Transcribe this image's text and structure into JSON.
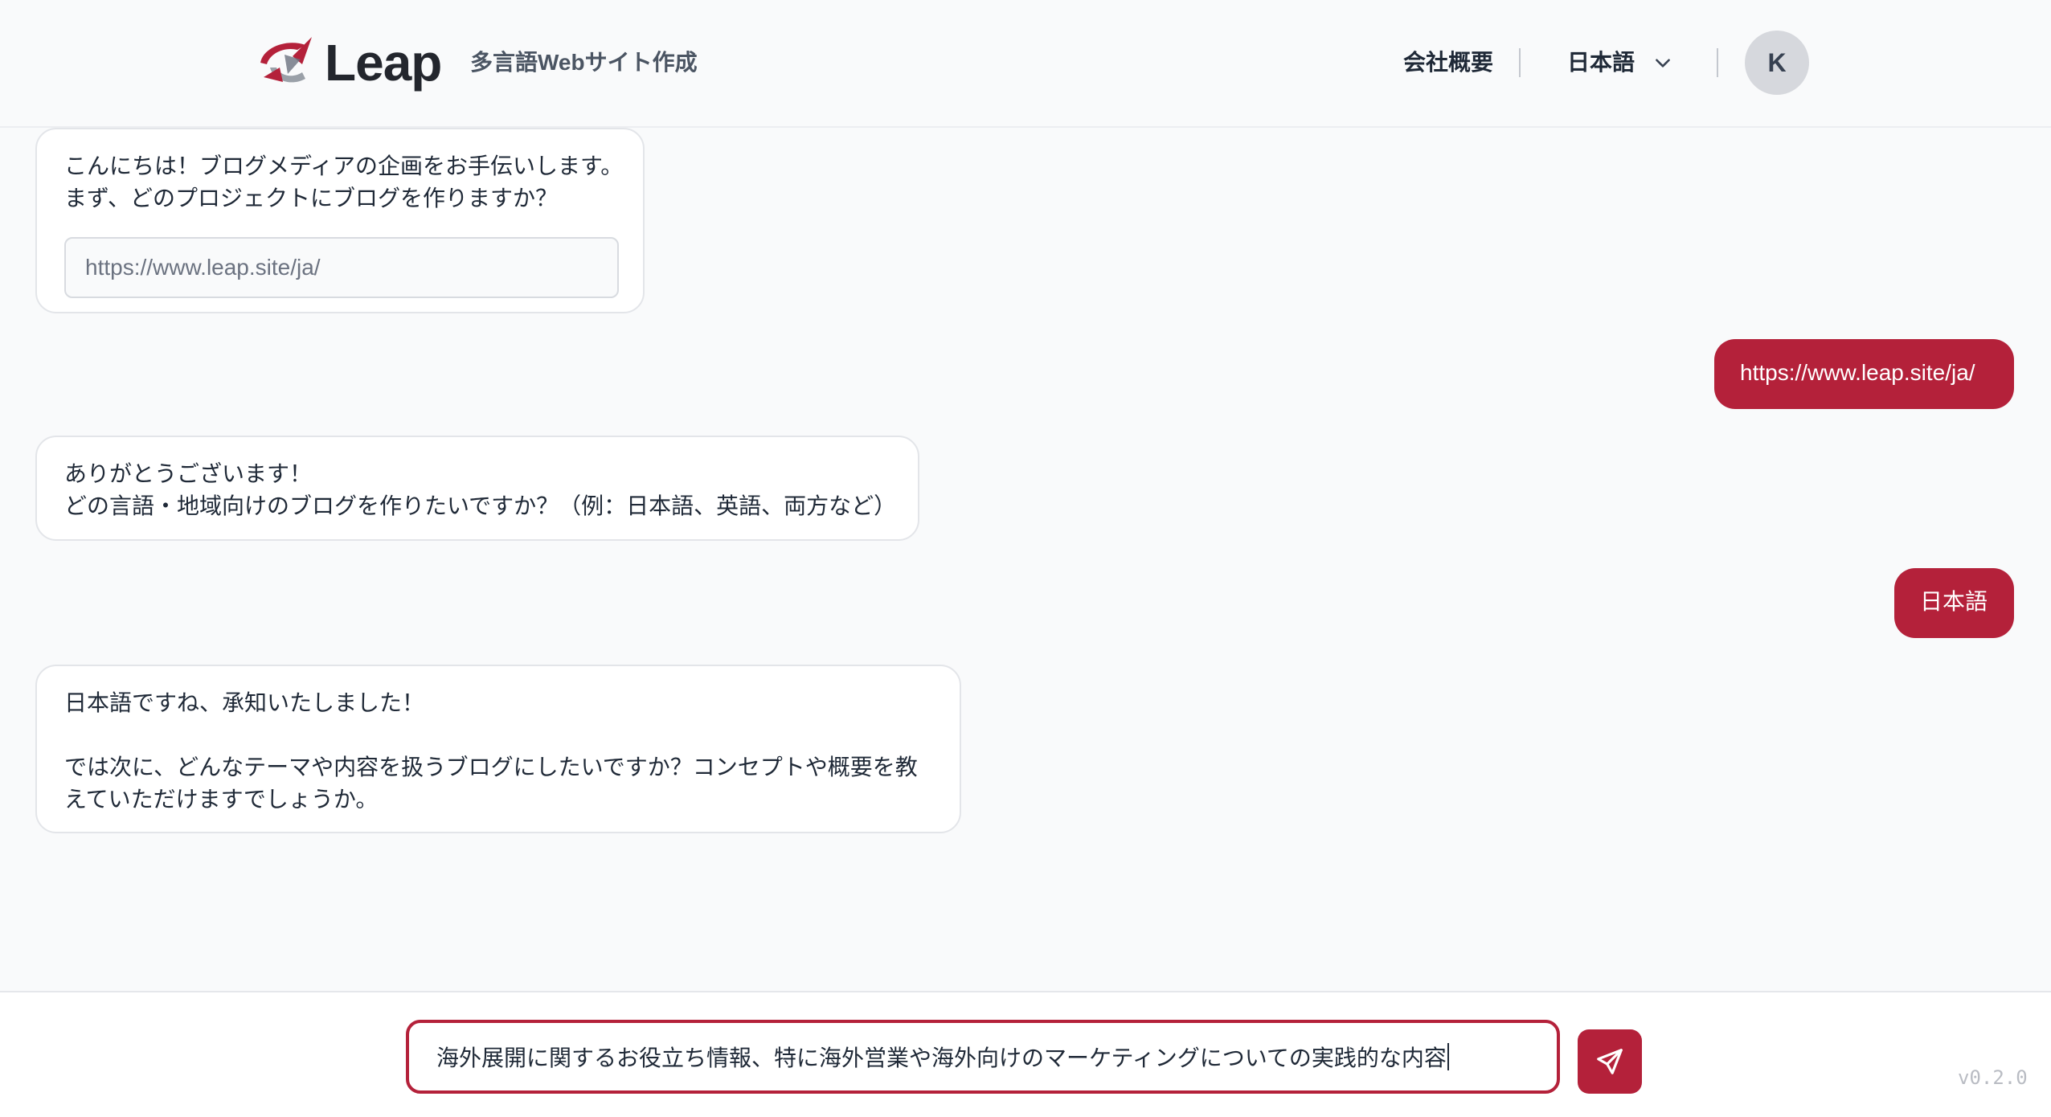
{
  "header": {
    "logo_text": "Leap",
    "tagline": "多言語Webサイト作成",
    "nav_about": "会社概要",
    "language": "日本語",
    "avatar_initial": "K"
  },
  "chat": {
    "messages": [
      {
        "role": "assistant",
        "lines": [
          "こんにちは！ブログメディアの企画をお手伝いします。",
          "まず、どのプロジェクトにブログを作りますか？"
        ],
        "input_value": "https://www.leap.site/ja/"
      },
      {
        "role": "user",
        "text": "https://www.leap.site/ja/"
      },
      {
        "role": "assistant",
        "lines": [
          "ありがとうございます！",
          "どの言語・地域向けのブログを作りたいですか？（例：日本語、英語、両方など）"
        ]
      },
      {
        "role": "user",
        "text": "日本語"
      },
      {
        "role": "assistant",
        "lines": [
          "日本語ですね、承知いたしました！",
          "",
          "では次に、どんなテーマや内容を扱うブログにしたいですか？コンセプトや概要を教",
          "えていただけますでしょうか。"
        ]
      }
    ]
  },
  "composer": {
    "input_value": "海外展開に関するお役立ち情報、特に海外営業や海外向けのマーケティングについての実践的な内容",
    "version": "v0.2.0"
  },
  "colors": {
    "accent": "#b4213a",
    "background": "#f9fafb"
  }
}
